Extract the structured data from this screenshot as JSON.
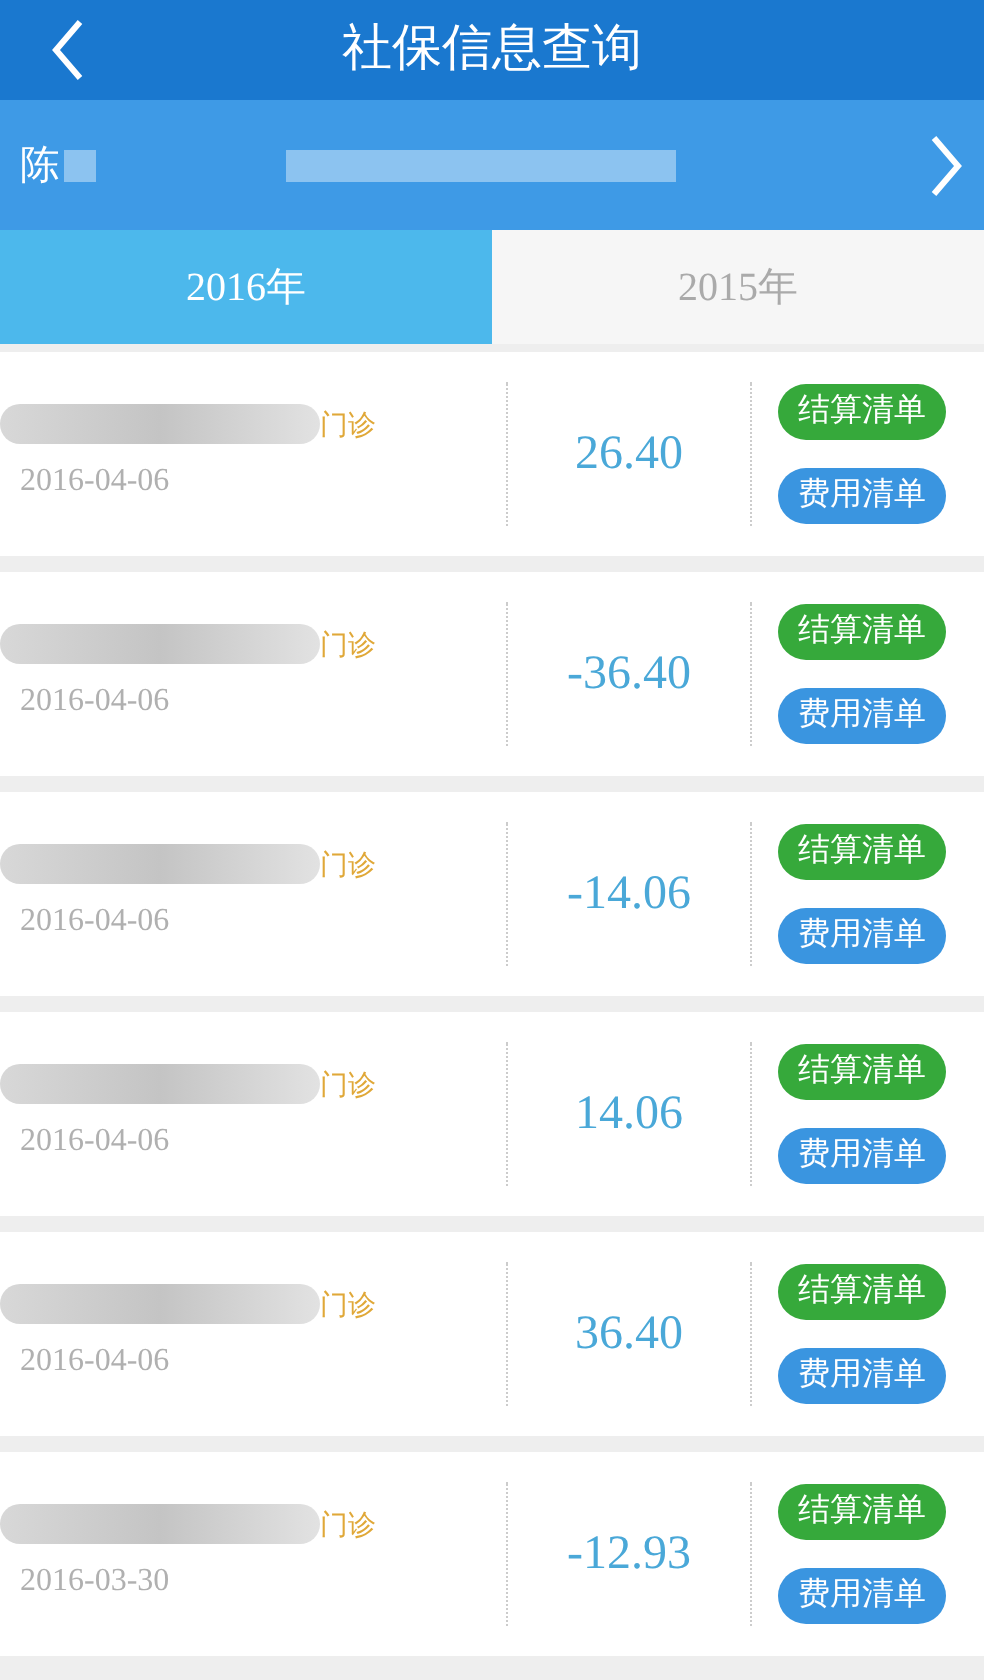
{
  "header": {
    "title": "社保信息查询"
  },
  "profile": {
    "name": "陈"
  },
  "tabs": [
    {
      "label": "2016年",
      "selected": true
    },
    {
      "label": "2015年",
      "selected": false
    }
  ],
  "records": [
    {
      "type": "门诊",
      "date": "2016-04-06",
      "amount": "26.40",
      "buttons": [
        "结算清单",
        "费用清单"
      ]
    },
    {
      "type": "门诊",
      "date": "2016-04-06",
      "amount": "-36.40",
      "buttons": [
        "结算清单",
        "费用清单"
      ]
    },
    {
      "type": "门诊",
      "date": "2016-04-06",
      "amount": "-14.06",
      "buttons": [
        "结算清单",
        "费用清单"
      ]
    },
    {
      "type": "门诊",
      "date": "2016-04-06",
      "amount": "14.06",
      "buttons": [
        "结算清单",
        "费用清单"
      ]
    },
    {
      "type": "门诊",
      "date": "2016-04-06",
      "amount": "36.40",
      "buttons": [
        "结算清单",
        "费用清单"
      ]
    },
    {
      "type": "门诊",
      "date": "2016-03-30",
      "amount": "-12.93",
      "buttons": [
        "结算清单",
        "费用清单"
      ]
    }
  ]
}
